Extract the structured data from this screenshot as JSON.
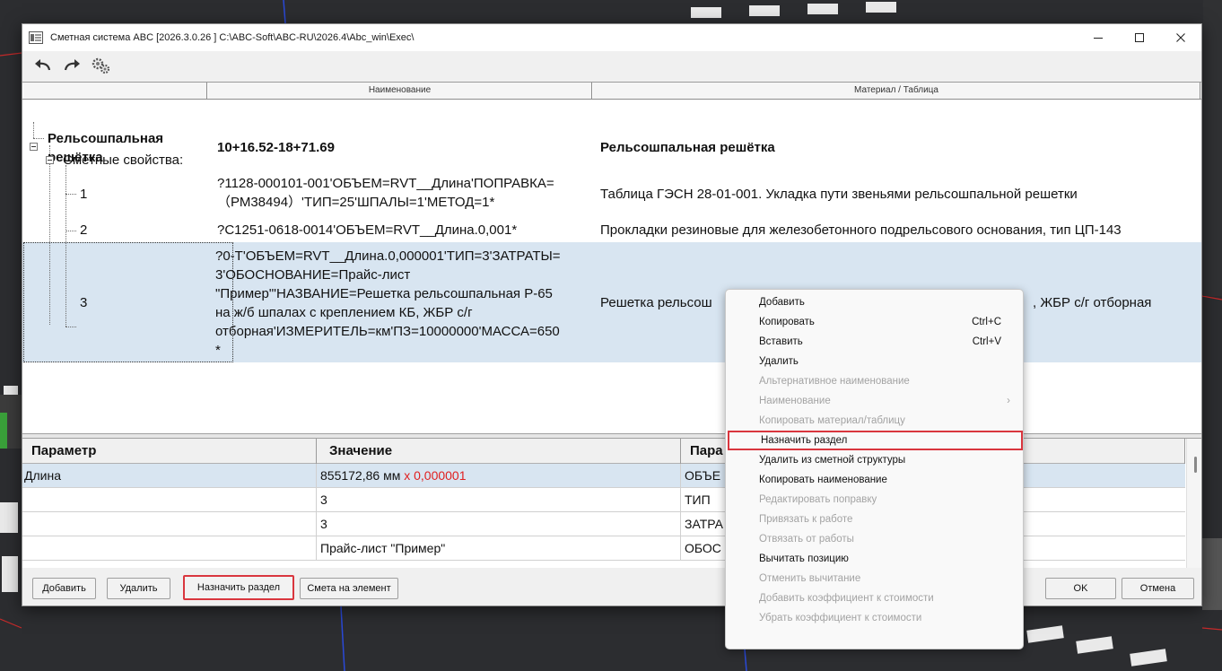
{
  "window": {
    "title": "Сметная система ABC [2026.3.0.26 ]   C:\\ABC-Soft\\ABC-RU\\2026.4\\Abc_win\\Exec\\"
  },
  "tree": {
    "headers": [
      "Наименование",
      "Материал / Таблица"
    ],
    "root": {
      "name_line1": "Рельсошпальная",
      "name_line2": "решётка",
      "value": "10+16.52-18+71.69",
      "material": "Рельсошпальная решётка"
    },
    "group_label": "Сметные свойства:",
    "rows": [
      {
        "num": "1",
        "name_lines": [
          "?1128-000101-001'ОБЪЕМ=RVT__Длина'ПОПРАВКА=",
          "（РМ38494）'ТИП=25'ШПАЛЫ=1'МЕТОД=1*"
        ],
        "material": "Таблица ГЭСН 28-01-001. Укладка пути звеньями рельсошпальной решетки"
      },
      {
        "num": "2",
        "name_lines": [
          "?С1251-0618-0014'ОБЪЕМ=RVT__Длина.0,001*"
        ],
        "material": "Прокладки резиновые для железобетонного подрельсового основания, тип ЦП-143"
      },
      {
        "num": "3",
        "name_lines": [
          "?0-Т'ОБЪЕМ=RVT__Длина.0,000001'ТИП=3'ЗАТРАТЫ=",
          "3'ОБОСНОВАНИЕ=Прайс-лист",
          "\"Пример\"'НАЗВАНИЕ=Решетка рельсошпальная Р-65",
          "на ж/б шпалах с креплением КБ, ЖБР с/г",
          "отборная'ИЗМЕРИТЕЛЬ=км'ПЗ=10000000'МАССА=650",
          "*"
        ],
        "material_left": "Решетка рельсош",
        "material_right": ", ЖБР с/г отборная"
      }
    ]
  },
  "properties": {
    "headers": [
      "Параметр",
      "Значение",
      "Пара"
    ],
    "rows": [
      {
        "param": "Длина",
        "value": "855172,86 мм",
        "mult_sign": "x",
        "mult": "0,000001",
        "param2": "ОБЪЕ"
      },
      {
        "param": "",
        "value": "3",
        "param2": "ТИП"
      },
      {
        "param": "",
        "value": "3",
        "param2": "ЗАТРА"
      },
      {
        "param": "",
        "value": "Прайс-лист \"Пример\"",
        "param2": "ОБОС"
      }
    ]
  },
  "buttons": {
    "add": "Добавить",
    "delete": "Удалить",
    "assign_section": "Назначить раздел",
    "element_estimate": "Смета на элемент",
    "ok": "OK",
    "cancel": "Отмена"
  },
  "context_menu": {
    "items": [
      {
        "label": "Добавить",
        "enabled": true
      },
      {
        "label": "Копировать",
        "shortcut": "Ctrl+C",
        "enabled": true
      },
      {
        "label": "Вставить",
        "shortcut": "Ctrl+V",
        "enabled": true
      },
      {
        "label": "Удалить",
        "enabled": true
      },
      {
        "label": "Альтернативное наименование",
        "enabled": false
      },
      {
        "label": "Наименование",
        "enabled": false,
        "submenu": true
      },
      {
        "label": "Копировать материал/таблицу",
        "enabled": false
      },
      {
        "label": "Назначить раздел",
        "enabled": true,
        "highlighted": true
      },
      {
        "label": "Удалить из сметной структуры",
        "enabled": true
      },
      {
        "label": "Копировать наименование",
        "enabled": true
      },
      {
        "label": "Редактировать поправку",
        "enabled": false
      },
      {
        "label": "Привязать к работе",
        "enabled": false
      },
      {
        "label": "Отвязать от работы",
        "enabled": false
      },
      {
        "label": "Вычитать позицию",
        "enabled": true
      },
      {
        "label": "Отменить вычитание",
        "enabled": false
      },
      {
        "label": "Добавить коэффициент к стоимости",
        "enabled": false
      },
      {
        "label": "Убрать коэффициент к стоимости",
        "enabled": false
      }
    ]
  },
  "colors": {
    "selection": "#d8e5f1",
    "highlight_border": "#d9363e",
    "disabled_text": "#a3a3a3",
    "accent_red": "#e02020"
  }
}
